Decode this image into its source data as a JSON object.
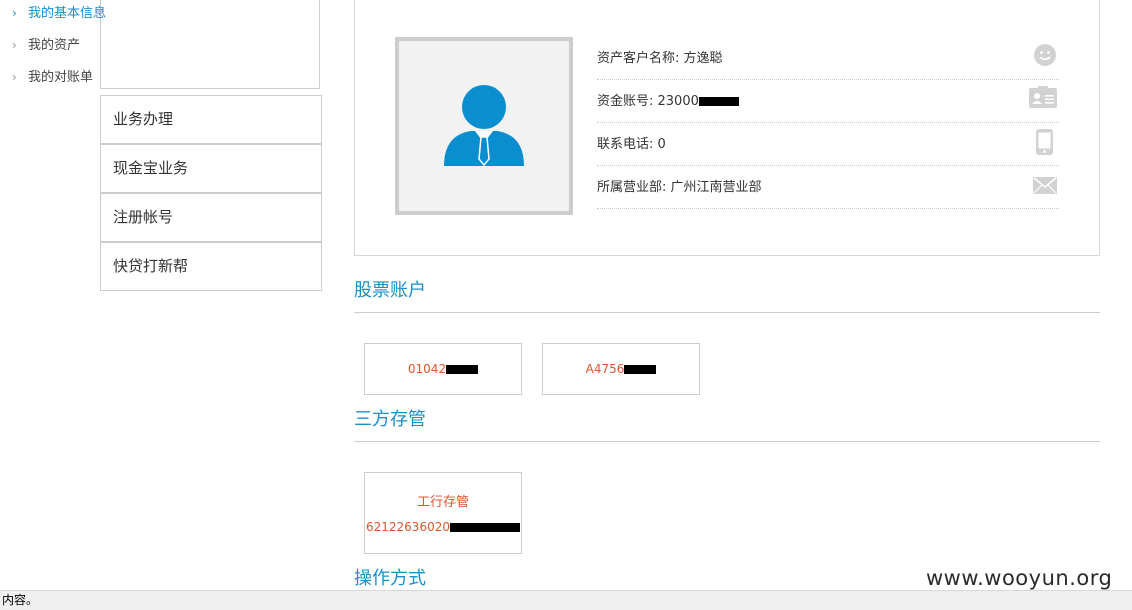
{
  "sidebar": {
    "sub_items": [
      {
        "label": "我的基本信息",
        "active": true
      },
      {
        "label": "我的资产",
        "active": false
      },
      {
        "label": "我的对账单",
        "active": false
      }
    ],
    "nav_items": [
      {
        "label": "业务办理"
      },
      {
        "label": "现金宝业务"
      },
      {
        "label": "注册帐号"
      },
      {
        "label": "快贷打新帮"
      }
    ],
    "chevron": "›"
  },
  "profile": {
    "avatar_icon": "user-avatar-icon",
    "rows": [
      {
        "label": "资产客户名称: 方逸聪",
        "icon": "smiley-icon"
      },
      {
        "label": "资金账号: 23000",
        "icon": "id-card-icon"
      },
      {
        "label": "联系电话: 0",
        "icon": "phone-icon"
      },
      {
        "label": "所属营业部: 广州江南营业部",
        "icon": "mail-icon"
      }
    ]
  },
  "stock_accounts": {
    "title": "股票账户",
    "accounts": [
      "01042",
      "A4756"
    ]
  },
  "custody": {
    "title": "三方存管",
    "bank": "工行存管",
    "account": "62122636020"
  },
  "operation": {
    "title": "操作方式"
  },
  "watermark": "www.wooyun.org",
  "status_bar": "内容。",
  "colors": {
    "accent": "#1a8fc9",
    "avatar": "#0a8ed0",
    "account_text": "#e0542e",
    "border": "#cccccc"
  }
}
